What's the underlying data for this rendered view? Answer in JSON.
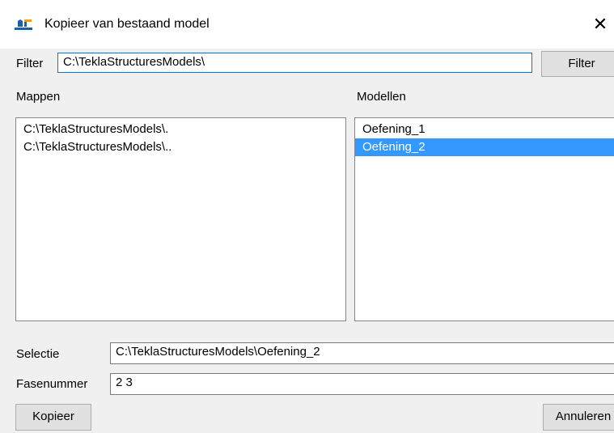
{
  "window": {
    "title": "Kopieer van bestaand model"
  },
  "filter": {
    "label": "Filter",
    "value": "C:\\TeklaStructuresModels\\",
    "button_label": "Filter"
  },
  "folders": {
    "label": "Mappen",
    "items": [
      {
        "text": "C:\\TeklaStructuresModels\\."
      },
      {
        "text": "C:\\TeklaStructuresModels\\.."
      }
    ]
  },
  "models": {
    "label": "Modellen",
    "items": [
      {
        "text": "Oefening_1",
        "selected": false
      },
      {
        "text": "Oefening_2",
        "selected": true
      }
    ]
  },
  "selection": {
    "label": "Selectie",
    "value": "C:\\TeklaStructuresModels\\Oefening_2"
  },
  "phase": {
    "label": "Fasenummer",
    "value": "2 3"
  },
  "buttons": {
    "copy": "Kopieer",
    "cancel": "Annuleren"
  },
  "colors": {
    "selection_highlight": "#3399ff",
    "focus_border": "#0078d7"
  },
  "icons": {
    "app": "tekla-model-icon",
    "close": "close-icon"
  }
}
